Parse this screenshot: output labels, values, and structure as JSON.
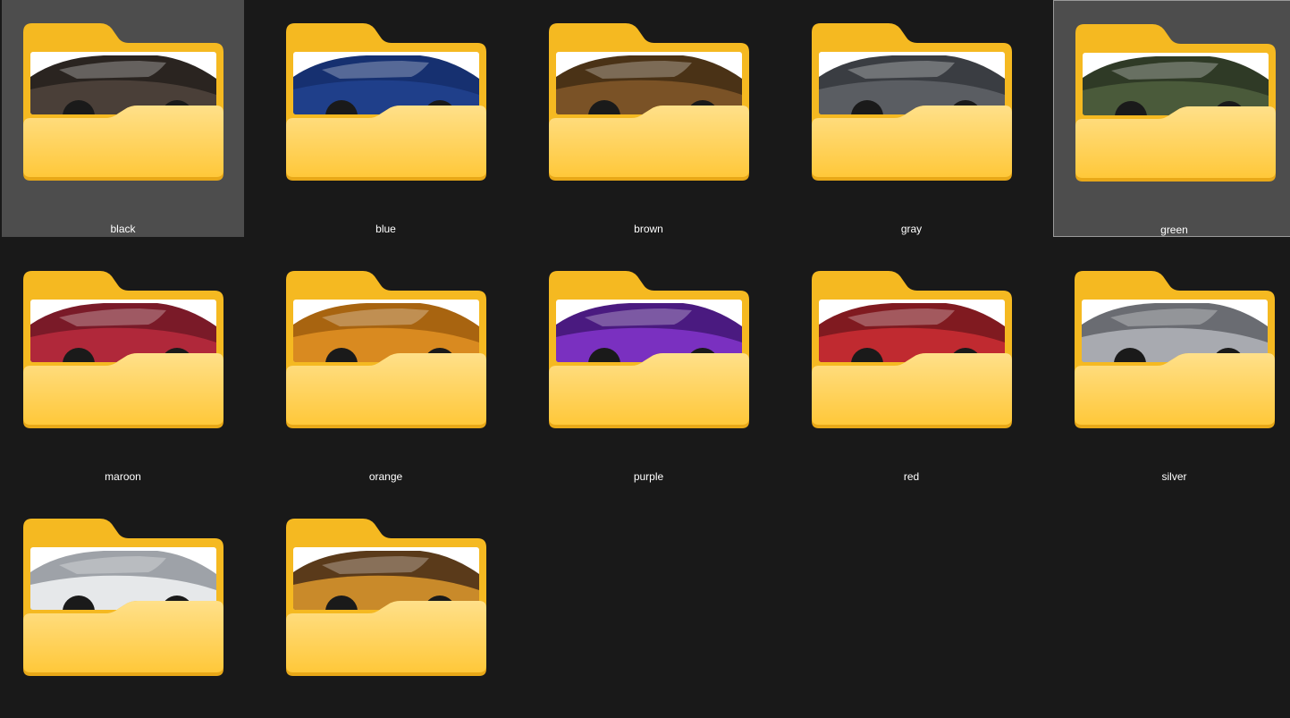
{
  "folders": [
    {
      "name": "black",
      "state": "hover",
      "car_body": "#4a3f38",
      "car_top": "#2a2420",
      "car_bg": "#ffffff"
    },
    {
      "name": "blue",
      "state": "normal",
      "car_body": "#1f3f8a",
      "car_top": "#163070",
      "car_bg": "#ffffff"
    },
    {
      "name": "brown",
      "state": "normal",
      "car_body": "#7a5226",
      "car_top": "#4a3216",
      "car_bg": "#ffffff"
    },
    {
      "name": "gray",
      "state": "normal",
      "car_body": "#5a5d62",
      "car_top": "#3a3d42",
      "car_bg": "#ffffff"
    },
    {
      "name": "green",
      "state": "selected",
      "car_body": "#4a5a3a",
      "car_top": "#2f3a26",
      "car_bg": "#ffffff"
    },
    {
      "name": "maroon",
      "state": "normal",
      "car_body": "#b0283a",
      "car_top": "#7a1a28",
      "car_bg": "#ffffff"
    },
    {
      "name": "orange",
      "state": "normal",
      "car_body": "#d98a20",
      "car_top": "#a86410",
      "car_bg": "#ffffff"
    },
    {
      "name": "purple",
      "state": "normal",
      "car_body": "#7a30c0",
      "car_top": "#4a1a80",
      "car_bg": "#ffffff"
    },
    {
      "name": "red",
      "state": "normal",
      "car_body": "#c02a30",
      "car_top": "#801a20",
      "car_bg": "#ffffff"
    },
    {
      "name": "silver",
      "state": "normal",
      "car_body": "#a8aab0",
      "car_top": "#6a6c72",
      "car_bg": "#ffffff"
    },
    {
      "name": "",
      "state": "normal",
      "car_body": "#e6e8ea",
      "car_top": "#9ea2a8",
      "car_bg": "#ffffff"
    },
    {
      "name": "",
      "state": "normal",
      "car_body": "#c98a2a",
      "car_top": "#5a3a1a",
      "car_bg": "#ffffff"
    }
  ],
  "colors": {
    "background": "#191919",
    "folder_back": "#f5b921",
    "folder_front_top": "#ffe08a",
    "folder_front_bottom": "#ffc83a",
    "folder_front_edge": "#e8a818"
  },
  "icon": "folder-with-thumbnail-icon"
}
